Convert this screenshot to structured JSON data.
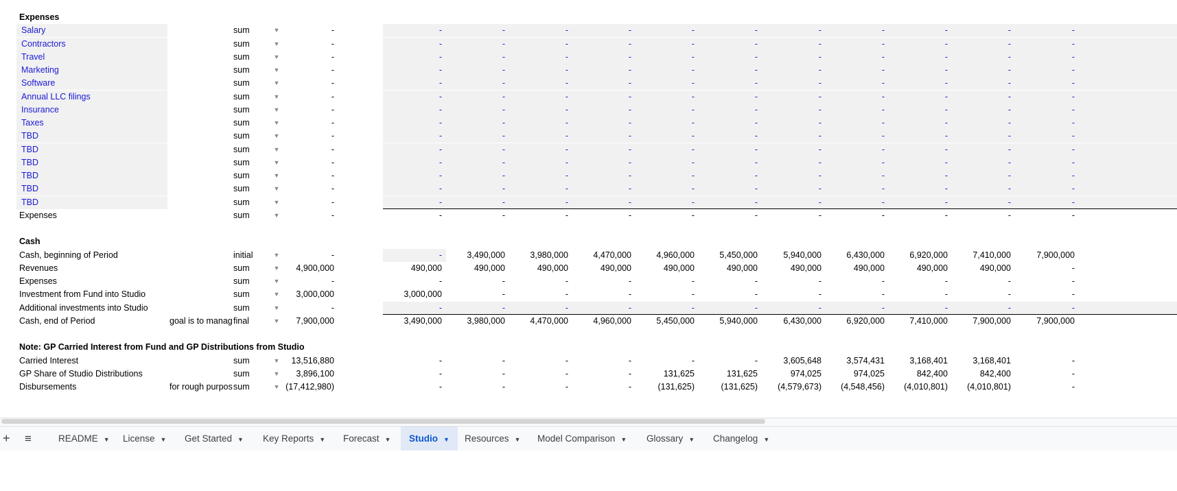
{
  "sections": [
    {
      "title": "Expenses",
      "rows": [
        {
          "label": "Salary",
          "agg": "sum",
          "total": "-",
          "values": [
            "-",
            "-",
            "-",
            "-",
            "-",
            "-",
            "-",
            "-",
            "-",
            "-",
            "-"
          ],
          "style": "input"
        },
        {
          "label": "Contractors",
          "agg": "sum",
          "total": "-",
          "values": [
            "-",
            "-",
            "-",
            "-",
            "-",
            "-",
            "-",
            "-",
            "-",
            "-",
            "-"
          ],
          "style": "input"
        },
        {
          "label": "Travel",
          "agg": "sum",
          "total": "-",
          "values": [
            "-",
            "-",
            "-",
            "-",
            "-",
            "-",
            "-",
            "-",
            "-",
            "-",
            "-"
          ],
          "style": "input"
        },
        {
          "label": "Marketing",
          "agg": "sum",
          "total": "-",
          "values": [
            "-",
            "-",
            "-",
            "-",
            "-",
            "-",
            "-",
            "-",
            "-",
            "-",
            "-"
          ],
          "style": "input"
        },
        {
          "label": "Software",
          "agg": "sum",
          "total": "-",
          "values": [
            "-",
            "-",
            "-",
            "-",
            "-",
            "-",
            "-",
            "-",
            "-",
            "-",
            "-"
          ],
          "style": "input"
        },
        {
          "label": "Annual LLC filings",
          "agg": "sum",
          "total": "-",
          "values": [
            "-",
            "-",
            "-",
            "-",
            "-",
            "-",
            "-",
            "-",
            "-",
            "-",
            "-"
          ],
          "style": "input"
        },
        {
          "label": "Insurance",
          "agg": "sum",
          "total": "-",
          "values": [
            "-",
            "-",
            "-",
            "-",
            "-",
            "-",
            "-",
            "-",
            "-",
            "-",
            "-"
          ],
          "style": "input"
        },
        {
          "label": "Taxes",
          "agg": "sum",
          "total": "-",
          "values": [
            "-",
            "-",
            "-",
            "-",
            "-",
            "-",
            "-",
            "-",
            "-",
            "-",
            "-"
          ],
          "style": "input"
        },
        {
          "label": "TBD",
          "agg": "sum",
          "total": "-",
          "values": [
            "-",
            "-",
            "-",
            "-",
            "-",
            "-",
            "-",
            "-",
            "-",
            "-",
            "-"
          ],
          "style": "input"
        },
        {
          "label": "TBD",
          "agg": "sum",
          "total": "-",
          "values": [
            "-",
            "-",
            "-",
            "-",
            "-",
            "-",
            "-",
            "-",
            "-",
            "-",
            "-"
          ],
          "style": "input"
        },
        {
          "label": "TBD",
          "agg": "sum",
          "total": "-",
          "values": [
            "-",
            "-",
            "-",
            "-",
            "-",
            "-",
            "-",
            "-",
            "-",
            "-",
            "-"
          ],
          "style": "input"
        },
        {
          "label": "TBD",
          "agg": "sum",
          "total": "-",
          "values": [
            "-",
            "-",
            "-",
            "-",
            "-",
            "-",
            "-",
            "-",
            "-",
            "-",
            "-"
          ],
          "style": "input"
        },
        {
          "label": "TBD",
          "agg": "sum",
          "total": "-",
          "values": [
            "-",
            "-",
            "-",
            "-",
            "-",
            "-",
            "-",
            "-",
            "-",
            "-",
            "-"
          ],
          "style": "input"
        },
        {
          "label": "TBD",
          "agg": "sum",
          "total": "-",
          "values": [
            "-",
            "-",
            "-",
            "-",
            "-",
            "-",
            "-",
            "-",
            "-",
            "-",
            "-"
          ],
          "style": "input"
        },
        {
          "label": "Expenses",
          "agg": "sum",
          "total": "-",
          "values": [
            "-",
            "-",
            "-",
            "-",
            "-",
            "-",
            "-",
            "-",
            "-",
            "-",
            "-"
          ],
          "style": "total"
        }
      ]
    },
    {
      "title": "Cash",
      "rows": [
        {
          "label": "Cash, beginning of Period",
          "agg": "initial",
          "total": "-",
          "values": [
            "-",
            "3,490,000",
            "3,980,000",
            "4,470,000",
            "4,960,000",
            "5,450,000",
            "5,940,000",
            "6,430,000",
            "6,920,000",
            "7,410,000",
            "7,900,000"
          ],
          "style": "first-input"
        },
        {
          "label": "Revenues",
          "agg": "sum",
          "total": "4,900,000",
          "values": [
            "490,000",
            "490,000",
            "490,000",
            "490,000",
            "490,000",
            "490,000",
            "490,000",
            "490,000",
            "490,000",
            "490,000",
            "-"
          ]
        },
        {
          "label": "Expenses",
          "agg": "sum",
          "total": "-",
          "values": [
            "-",
            "-",
            "-",
            "-",
            "-",
            "-",
            "-",
            "-",
            "-",
            "-",
            "-"
          ]
        },
        {
          "label": "Investment from Fund into Studio",
          "agg": "sum",
          "total": "3,000,000",
          "values": [
            "3,000,000",
            "-",
            "-",
            "-",
            "-",
            "-",
            "-",
            "-",
            "-",
            "-",
            "-"
          ]
        },
        {
          "label": "Additional investments into Studio",
          "agg": "sum",
          "total": "-",
          "values": [
            "-",
            "-",
            "-",
            "-",
            "-",
            "-",
            "-",
            "-",
            "-",
            "-",
            "-"
          ],
          "style": "input"
        },
        {
          "label": "Cash, end of Period",
          "note": "goal is to manag",
          "agg": "final",
          "total": "7,900,000",
          "values": [
            "3,490,000",
            "3,980,000",
            "4,470,000",
            "4,960,000",
            "5,450,000",
            "5,940,000",
            "6,430,000",
            "6,920,000",
            "7,410,000",
            "7,900,000",
            "7,900,000"
          ],
          "style": "total"
        }
      ]
    },
    {
      "title": "Note: GP Carried Interest from Fund and GP Distributions from Studio",
      "rows": [
        {
          "label": "Carried Interest",
          "agg": "sum",
          "total": "13,516,880",
          "values": [
            "-",
            "-",
            "-",
            "-",
            "-",
            "-",
            "3,605,648",
            "3,574,431",
            "3,168,401",
            "3,168,401",
            "-"
          ]
        },
        {
          "label": "GP Share of Studio Distributions",
          "agg": "sum",
          "total": "3,896,100",
          "values": [
            "-",
            "-",
            "-",
            "-",
            "131,625",
            "131,625",
            "974,025",
            "974,025",
            "842,400",
            "842,400",
            "-"
          ]
        },
        {
          "label": "Disbursements",
          "note": "for rough purpos",
          "agg": "sum",
          "total": "(17,412,980)",
          "values": [
            "-",
            "-",
            "-",
            "-",
            "(131,625)",
            "(131,625)",
            "(4,579,673)",
            "(4,548,456)",
            "(4,010,801)",
            "(4,010,801)",
            "-"
          ]
        }
      ]
    }
  ],
  "tabbar": {
    "add_icon": "plus-icon",
    "menu_icon": "hamburger-icon",
    "active": "Studio",
    "tabs": [
      "README",
      "License",
      "Get Started",
      "Key Reports",
      "Forecast",
      "Studio",
      "Resources",
      "Model Comparison",
      "Glossary",
      "Changelog"
    ]
  },
  "colors": {
    "input_text": "#1a1ad6",
    "input_bg": "#f1f1f1",
    "active_tab_bg": "#e1e9f7",
    "active_tab_text": "#0b57d0"
  }
}
